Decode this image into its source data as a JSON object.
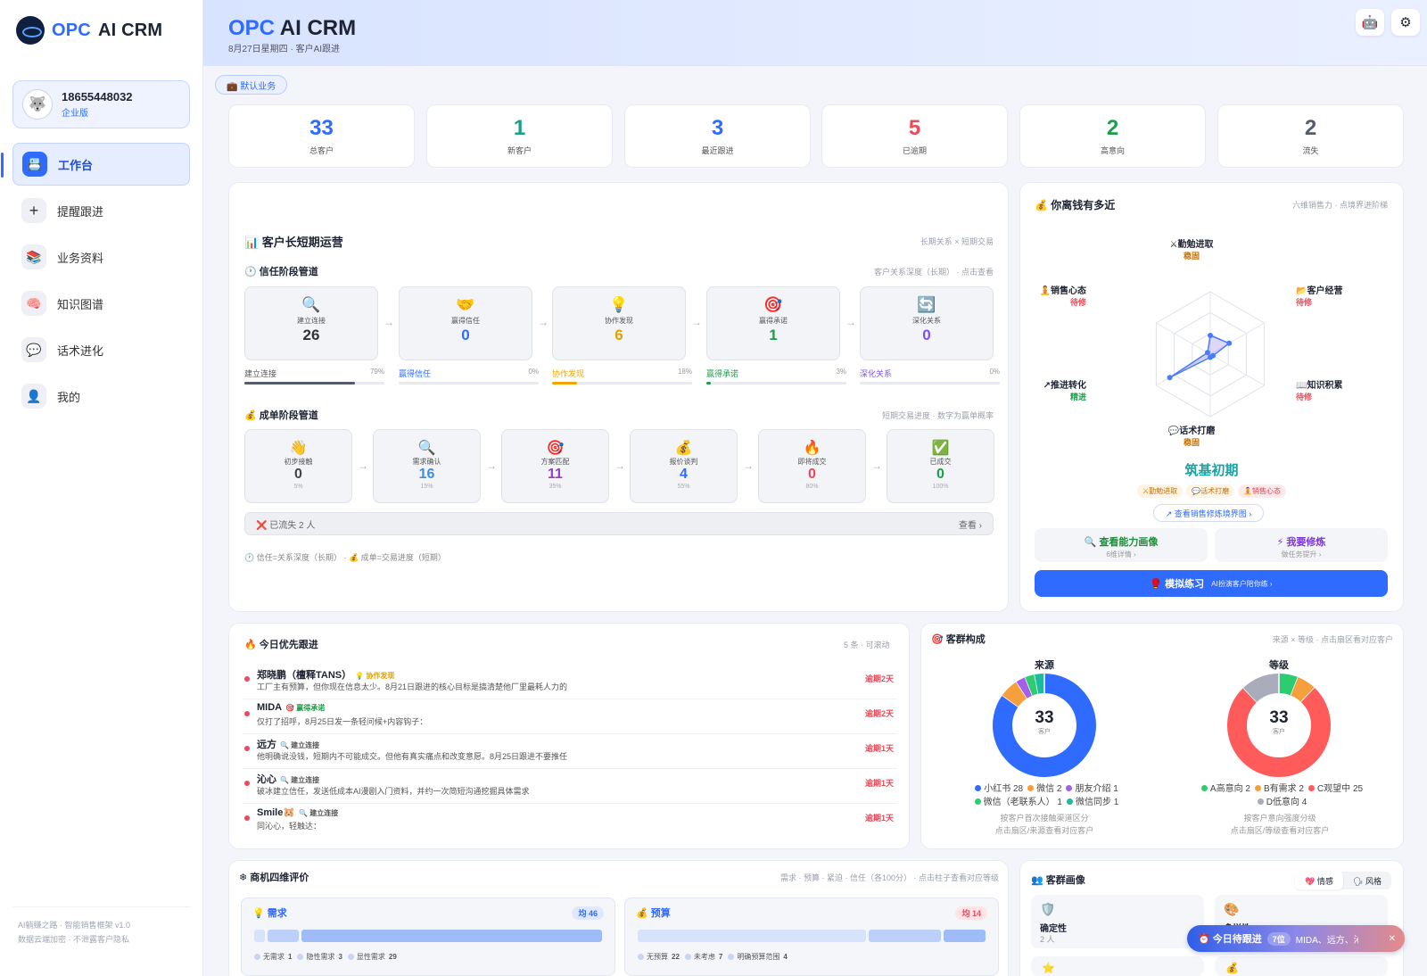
{
  "app": {
    "brand_prefix": "OPC",
    "brand_suffix": "AI CRM"
  },
  "account": {
    "phone": "18655448032",
    "tier": "企业版"
  },
  "nav": [
    {
      "label": "工作台",
      "icon": "desk-icon",
      "glyph": "📇"
    },
    {
      "label": "提醒跟进",
      "icon": "plus-icon",
      "glyph": "+"
    },
    {
      "label": "业务资料",
      "icon": "books-icon",
      "glyph": "📚"
    },
    {
      "label": "知识图谱",
      "icon": "brain-icon",
      "glyph": "🧠"
    },
    {
      "label": "话术进化",
      "icon": "speech-bubble-icon",
      "glyph": "💬"
    },
    {
      "label": "我的",
      "icon": "user-icon",
      "glyph": "👤"
    }
  ],
  "sidebar_footer": {
    "line1": "AI躺赚之路 · 智能销售框架 v1.0",
    "line2": "数据云端加密 · 不泄露客户隐私"
  },
  "header": {
    "date": "8月27日星期四 · 客户AI跟进"
  },
  "business_tag": "💼 默认业务",
  "stats": [
    {
      "value": "33",
      "label": "总客户",
      "color": "#2f6bff"
    },
    {
      "value": "1",
      "label": "新客户",
      "color": "#16a085"
    },
    {
      "value": "3",
      "label": "最近跟进",
      "color": "#2f6bff"
    },
    {
      "value": "5",
      "label": "已逾期",
      "color": "#e94b5a"
    },
    {
      "value": "2",
      "label": "高意向",
      "color": "#1e9e4a"
    },
    {
      "value": "2",
      "label": "流失",
      "color": "#555c6b"
    }
  ],
  "ops": {
    "title": "📊 客户长短期运营",
    "meta": "长期关系 × 短期交易",
    "trust_title": "🕐 信任阶段管道",
    "trust_meta": "客户关系深度（长期） · 点击查看",
    "trust_stages": [
      {
        "icon": "🔍",
        "name": "建立连接",
        "value": "26",
        "color": "#333",
        "pct": "79%",
        "fill": 0.79,
        "bar": "#555c6b"
      },
      {
        "icon": "🤝",
        "name": "赢得信任",
        "value": "0",
        "color": "#2f6bff",
        "pct": "0%",
        "fill": 0,
        "bar": "#2f6bff"
      },
      {
        "icon": "💡",
        "name": "协作发现",
        "value": "6",
        "color": "#e0a000",
        "pct": "18%",
        "fill": 0.18,
        "bar": "#f0a500"
      },
      {
        "icon": "🎯",
        "name": "赢得承诺",
        "value": "1",
        "color": "#1e9e4a",
        "pct": "3%",
        "fill": 0.03,
        "bar": "#1e9e4a"
      },
      {
        "icon": "🔄",
        "name": "深化关系",
        "value": "0",
        "color": "#7c4dff",
        "pct": "0%",
        "fill": 0,
        "bar": "#7c4dff"
      }
    ],
    "deal_title": "💰 成单阶段管道",
    "deal_meta": "短期交易进度 · 数字为赢单概率",
    "deal_stages": [
      {
        "icon": "👋",
        "name": "初步接触",
        "value": "0",
        "pct": "5%",
        "color": "#444"
      },
      {
        "icon": "🔍",
        "name": "需求确认",
        "value": "16",
        "pct": "15%",
        "color": "#3a8ee6"
      },
      {
        "icon": "🎯",
        "name": "方案匹配",
        "value": "11",
        "pct": "35%",
        "color": "#9b3cc9"
      },
      {
        "icon": "💰",
        "name": "报价谈判",
        "value": "4",
        "pct": "55%",
        "color": "#2f6bff"
      },
      {
        "icon": "🔥",
        "name": "即将成交",
        "value": "0",
        "pct": "80%",
        "color": "#e94b5a"
      },
      {
        "icon": "✅",
        "name": "已成交",
        "value": "0",
        "pct": "100%",
        "color": "#1e9e4a"
      }
    ],
    "lost_label": "❌ 已流失 2 人",
    "lost_link": "查看 ›",
    "footnote": "🕐 信任=关系深度（长期） · 💰 成单=交易进度（短期）"
  },
  "skills": {
    "title": "💰 你离钱有多近",
    "meta": "六维销售力 · 点境界进阶梯",
    "dimensions": [
      {
        "label": "⚔勤勉进取",
        "status": "稳固",
        "value": 0.3
      },
      {
        "label": "📂客户经营",
        "status": "待修",
        "value": 0.35
      },
      {
        "label": "📖知识积累",
        "status": "待修",
        "value": 0.05
      },
      {
        "label": "💬话术打磨",
        "status": "稳固",
        "value": 0.05
      },
      {
        "label": "↗推进转化",
        "status": "精进",
        "value": 0.75
      },
      {
        "label": "🧘销售心态",
        "status": "待修",
        "value": 0.05
      }
    ],
    "realm": "筑基初期",
    "chips": [
      "⚔勤勉进取",
      "💬话术打磨",
      "🧘销售心态"
    ],
    "ladder_link": "↗ 查看销售修炼境界图 ›",
    "profile_btn": "🔍 查看能力画像",
    "profile_sub": "6维详情 ›",
    "practice_btn": "⚡ 我要修炼",
    "practice_sub": "做任务提升 ›",
    "sim_btn": "🥊 模拟练习",
    "sim_sub": "AI扮演客户陪你练 ›"
  },
  "followups": {
    "title": "🔥 今日优先跟进",
    "meta": "5 条 · 可滚动",
    "items": [
      {
        "name": "郑晓鹏（檀释TANS）",
        "tag": "💡 协作发现",
        "tag_color": "#e0a000",
        "desc": "工厂主有预算，但你现在信息太少。8月21日跟进的核心目标是搞清楚他厂里最耗人力的",
        "due": "逾期2天"
      },
      {
        "name": "MIDA",
        "tag": "🎯 赢得承诺",
        "tag_color": "#1e9e4a",
        "desc": "仅打了招呼，8月25日发一条轻问候+内容钩子：",
        "due": "逾期2天"
      },
      {
        "name": "远方",
        "tag": "🔍 建立连接",
        "tag_color": "#555",
        "desc": "他明确说没钱，短期内不可能成交。但他有真实痛点和改变意愿。8月25日跟进不要推任",
        "due": "逾期1天"
      },
      {
        "name": "沁心",
        "tag": "🔍 建立连接",
        "tag_color": "#555",
        "desc": "破冰建立信任，发送低成本AI漫剧入门资料，并约一次简短沟通挖掘具体需求",
        "due": "逾期1天"
      },
      {
        "name": "Smile🐹",
        "tag": "🔍 建立连接",
        "tag_color": "#555",
        "desc": "同沁心，轻触达：",
        "due": "逾期1天"
      }
    ]
  },
  "segments": {
    "title": "🎯 客群构成",
    "meta": "来源 × 等级 · 点击扇区看对应客户",
    "source": {
      "title": "来源",
      "total": "33",
      "unit": "客户",
      "slices": [
        {
          "label": "小红书",
          "value": 28,
          "color": "#2f6bff"
        },
        {
          "label": "微信",
          "value": 2,
          "color": "#f5a03c"
        },
        {
          "label": "朋友介绍",
          "value": 1,
          "color": "#a55eea"
        },
        {
          "label": "微信（老联系人）",
          "value": 1,
          "color": "#2ecc71"
        },
        {
          "label": "微信同步",
          "value": 1,
          "color": "#1abc9c"
        }
      ],
      "legend_line1": [
        "小红书 28",
        "微信 2",
        "朋友介绍 1"
      ],
      "legend_line2": [
        "微信（老联系人） 1",
        "微信同步 1"
      ],
      "note1": "按客户首次接触渠道区分",
      "note2": "点击扇区/来源查看对应客户"
    },
    "grade": {
      "title": "等级",
      "total": "33",
      "unit": "客户",
      "slices": [
        {
          "label": "A高意向",
          "value": 2,
          "color": "#2ecc71"
        },
        {
          "label": "B有需求",
          "value": 2,
          "color": "#f5a03c"
        },
        {
          "label": "C观望中",
          "value": 25,
          "color": "#ff5b5b"
        },
        {
          "label": "D低意向",
          "value": 4,
          "color": "#a9adbb"
        }
      ],
      "legend_line1": [
        "A高意向 2",
        "B有需求 2",
        "C观望中 25"
      ],
      "legend_line2": [
        "D低意向 4"
      ],
      "note1": "按客户意向强度分级",
      "note2": "点击扇区/等级查看对应客户"
    }
  },
  "four_dim": {
    "title": "❄ 商机四维评价",
    "meta": "需求 · 预算 · 紧迫 · 信任（各100分） · 点击柱子查看对应等级",
    "cards": [
      {
        "title": "💡 需求",
        "avg": "均 46",
        "avg_color": "#2f6bff",
        "avg_bg": "#dfe8ff",
        "legend": [
          {
            "k": "无需求",
            "v": "1"
          },
          {
            "k": "隐性需求",
            "v": "3"
          },
          {
            "k": "显性需求",
            "v": "29"
          }
        ]
      },
      {
        "title": "💰 预算",
        "avg": "均 14",
        "avg_color": "#e94b5a",
        "avg_bg": "#ffe3e5",
        "legend": [
          {
            "k": "无预算",
            "v": "22"
          },
          {
            "k": "未考虑",
            "v": "7"
          },
          {
            "k": "明确预算范围",
            "v": "4"
          }
        ]
      }
    ]
  },
  "portrait": {
    "title": "👥 客群画像",
    "seg_a": "💖 情感",
    "seg_b": "🗣 风格",
    "tiles": [
      {
        "icon": "🛡️",
        "label": "确定性",
        "count": "2 人"
      },
      {
        "icon": "🎨",
        "label": "多样性",
        "count": ""
      }
    ]
  },
  "floating": {
    "label": "⏰ 今日待跟进",
    "count": "7位",
    "names": "MIDA、远方、沁心",
    "close": "✕"
  }
}
